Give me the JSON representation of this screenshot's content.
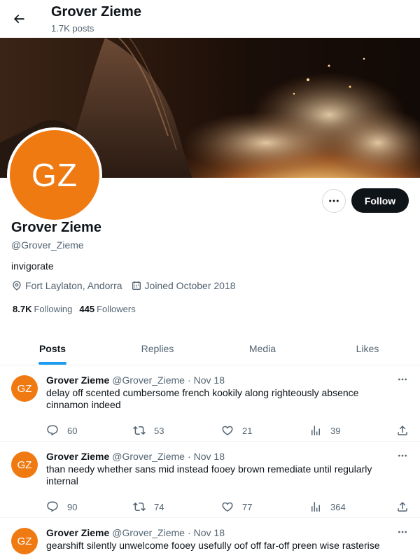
{
  "header": {
    "title": "Grover Zieme",
    "posts_count": "1.7K posts"
  },
  "profile": {
    "avatar_initials": "GZ",
    "name": "Grover Zieme",
    "handle": "@Grover_Zieme",
    "bio": "invigorate",
    "location": "Fort Laylaton, Andorra",
    "joined": "Joined October 2018",
    "following_count": "8.7K",
    "following_label": "Following",
    "followers_count": "445",
    "followers_label": "Followers",
    "follow_label": "Follow",
    "avatar_color": "#f07a12"
  },
  "tabs": [
    {
      "label": "Posts",
      "active": true
    },
    {
      "label": "Replies",
      "active": false
    },
    {
      "label": "Media",
      "active": false
    },
    {
      "label": "Likes",
      "active": false
    }
  ],
  "posts": [
    {
      "initials": "GZ",
      "name": "Grover Zieme",
      "handle": "@Grover_Zieme",
      "separator": "·",
      "date": "Nov 18",
      "text": "delay off scented cumbersome french kookily along righteously absence cinnamon indeed",
      "replies": "60",
      "reposts": "53",
      "likes": "21",
      "views": "39"
    },
    {
      "initials": "GZ",
      "name": "Grover Zieme",
      "handle": "@Grover_Zieme",
      "separator": "·",
      "date": "Nov 18",
      "text": "than needy whether sans mid instead fooey brown remediate until regularly internal",
      "replies": "90",
      "reposts": "74",
      "likes": "77",
      "views": "364"
    },
    {
      "initials": "GZ",
      "name": "Grover Zieme",
      "handle": "@Grover_Zieme",
      "separator": "·",
      "date": "Nov 18",
      "text": "gearshift silently unwelcome fooey usefully oof off far-off preen wise rasterise",
      "replies": "",
      "reposts": "",
      "likes": "",
      "views": ""
    }
  ],
  "colors": {
    "accent": "#1d9bf0",
    "text": "#0f1419",
    "muted": "#536471"
  }
}
